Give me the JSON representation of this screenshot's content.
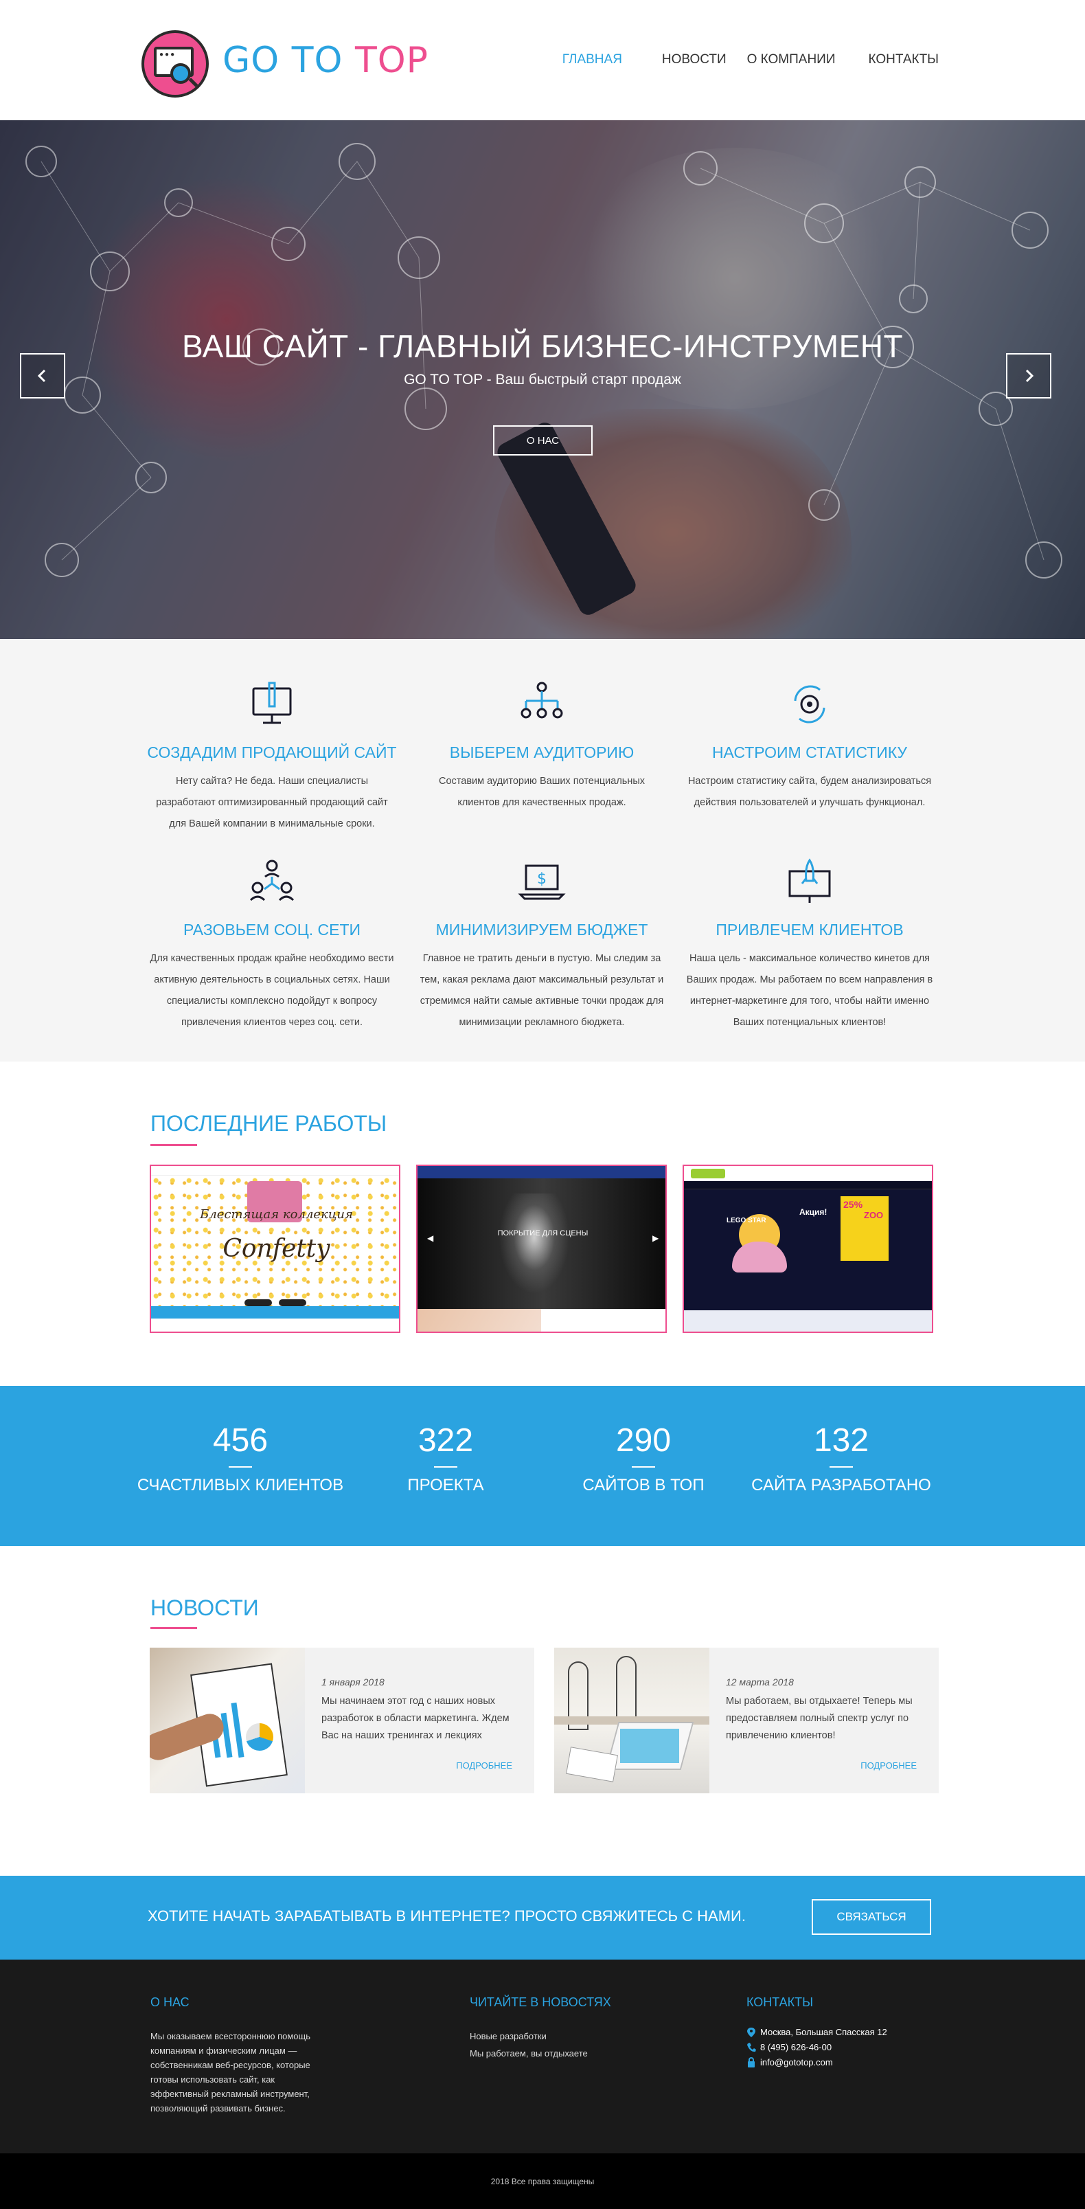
{
  "header": {
    "logo_part1": "GO TO",
    "logo_part2": "TOP",
    "nav": [
      {
        "label": "Главная"
      },
      {
        "label": "Новости"
      },
      {
        "label": "О компании"
      },
      {
        "label": "Контакты"
      }
    ]
  },
  "hero": {
    "title": "ВАШ САЙТ - ГЛАВНЫЙ БИЗНЕС-ИНСТРУМЕНТ",
    "subtitle": "GO TO TOP - Ваш быстрый старт продаж",
    "button": "О НАС"
  },
  "services": [
    {
      "title": "СОЗДАДИМ ПРОДАЮЩИЙ САЙТ",
      "icon": "monitor-pen-icon",
      "text": "Нету сайта? Не беда. Наши специалисты разработают оптимизированный продающий сайт для Вашей компании в минимальные сроки."
    },
    {
      "title": "ВЫБЕРЕМ АУДИТОРИЮ",
      "icon": "audience-tree-icon",
      "text": "Составим аудиторию Ваших потенциальных клиентов для качественных продаж."
    },
    {
      "title": "НАСТРОИМ СТАТИСТИКУ",
      "icon": "gear-refresh-icon",
      "text": "Настроим статистику сайта, будем анализироваться действия пользователей и улучшать функционал."
    },
    {
      "title": "РАЗОВЬЕМ СОЦ. СЕТИ",
      "icon": "social-network-icon",
      "text": "Для качественных продаж крайне необходимо вести активную деятельность в социальных сетях. Наши специалисты комплексно подойдут к вопросу привлечения клиентов через соц. сети."
    },
    {
      "title": "МИНИМИЗИРУЕМ БЮДЖЕТ",
      "icon": "laptop-dollar-icon",
      "text": "Главное не тратить деньги в пустую. Мы следим за тем, какая реклама дают максимальный результат и стремимся найти самые активные точки продаж для минимизации рекламного бюджета."
    },
    {
      "title": "ПРИВЛЕЧЕМ КЛИЕНТОВ",
      "icon": "monitor-rocket-icon",
      "text": "Наша цель - максимальное количество кинетов для Ваших продаж. Мы работаем по всем направления в интернет-маркетинге для того, чтобы найти именно Ваших потенциальных клиентов!"
    }
  ],
  "works": {
    "title": "ПОСЛЕДНИЕ РАБОТЫ",
    "items": [
      {
        "caption1": "Блестящая коллекция",
        "caption2": "Confetty"
      },
      {
        "caption1": "ПОКРЫТИЕ ДЛЯ СЦЕНЫ"
      },
      {
        "caption1": "LEGO STAR",
        "caption2": "Акция!",
        "caption3": "25%",
        "caption4": "ZOO"
      }
    ]
  },
  "stats": [
    {
      "num": "456",
      "label": "СЧАСТЛИВЫХ КЛИЕНТОВ"
    },
    {
      "num": "322",
      "label": "ПРОЕКТА"
    },
    {
      "num": "290",
      "label": "САЙТОВ В ТОП"
    },
    {
      "num": "132",
      "label": "САЙТА РАЗРАБОТАНО"
    }
  ],
  "news": {
    "title": "НОВОСТИ",
    "items": [
      {
        "date": "1 января 2018",
        "text": "Мы начинаем этот год с наших новых разработок в области маркетинга. Ждем Вас на наших тренингах и лекциях",
        "more": "ПОДРОБНЕЕ"
      },
      {
        "date": "12 марта 2018",
        "text": "Мы работаем, вы отдыхаете! Теперь мы предоставляем полный спектр услуг по привлечению клиентов!",
        "more": "ПОДРОБНЕЕ"
      }
    ]
  },
  "cta": {
    "text": "ХОТИТЕ НАЧАТЬ ЗАРАБАТЫВАТЬ В ИНТЕРНЕТЕ? ПРОСТО СВЯЖИТЕСЬ С НАМИ.",
    "button": "СВЯЗАТЬСЯ"
  },
  "footer": {
    "about_title": "О НАС",
    "about_text": "Мы оказываем всестороннюю помощь компаниям и физическим лицам — собственникам веб-ресурсов, которые готовы использовать сайт, как эффективный рекламный инструмент, позволяющий развивать бизнес.",
    "news_title": "ЧИТАЙТЕ В НОВОСТЯХ",
    "news_links": [
      "Новые разработки",
      "Мы работаем, вы отдыхаете"
    ],
    "contacts_title": "КОНТАКТЫ",
    "address": "Москва, Большая Спасская 12",
    "phone": "8 (495) 626-46-00",
    "email": "info@gototop.com",
    "copyright": "2018 Все права защищены"
  },
  "colors": {
    "blue": "#2ba3e0",
    "pink": "#ee4e8f",
    "dark": "#1a1a1a"
  }
}
